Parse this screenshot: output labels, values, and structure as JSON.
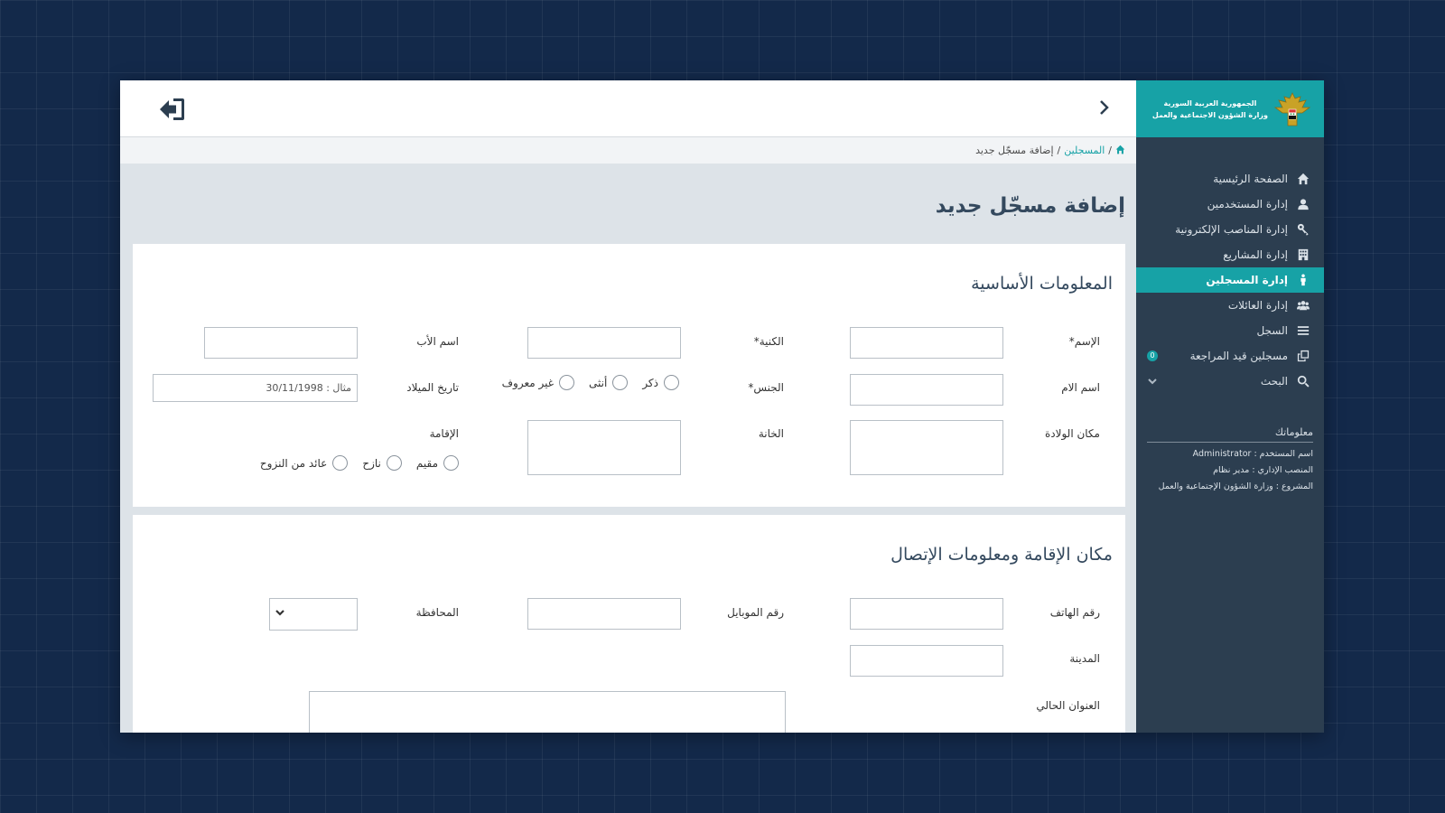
{
  "sidebar": {
    "logo_lines": [
      "الجمهورية العربية السورية",
      "وزارة الشؤون الاجتماعية والعمل"
    ],
    "items": [
      {
        "label": "الصفحة الرئيسية",
        "icon": "home-icon"
      },
      {
        "label": "إدارة المستخدمين",
        "icon": "user-icon"
      },
      {
        "label": "إدارة المناصب الإلكترونية",
        "icon": "key-icon"
      },
      {
        "label": "إدارة المشاريع",
        "icon": "building-icon"
      },
      {
        "label": "إدارة المسجلين",
        "icon": "person-icon",
        "active": true
      },
      {
        "label": "إدارة العائلات",
        "icon": "users-icon"
      },
      {
        "label": "السجل",
        "icon": "list-icon"
      },
      {
        "label": "مسجلين قيد المراجعة",
        "icon": "clone-icon",
        "badge": "0"
      },
      {
        "label": "البحث",
        "icon": "search-icon"
      }
    ],
    "info": {
      "title": "معلوماتك",
      "username": "اسم المستخدم : Administrator",
      "role": "المنصب الإداري : مدير نظام",
      "project": "المشروع : وزارة الشؤون الإجتماعية والعمل"
    }
  },
  "breadcrumb": {
    "link": "المسجلين",
    "separator1": "/",
    "separator2": "/",
    "current": "إضافة مسجّل جديد"
  },
  "page": {
    "title": "إضافة مسجّل جديد"
  },
  "basic_info": {
    "title": "المعلومات الأساسية",
    "first_name_label": "الإسم*",
    "surname_label": "الكنية*",
    "father_name_label": "اسم الأب",
    "mother_name_label": "اسم الام",
    "gender_label": "الجنس*",
    "gender_options": [
      "ذكر",
      "أنثى",
      "غير معروف"
    ],
    "birth_date_label": "تاريخ الميلاد",
    "birth_date_placeholder": "مثال : 30/11/1998",
    "birth_place_label": "مكان الولادة",
    "registry_label": "الخانة",
    "residence_label": "الإقامة",
    "residence_options": [
      "مقيم",
      "نازح",
      "عائد من النزوح"
    ]
  },
  "contact_info": {
    "title": "مكان الإقامة ومعلومات الإتصال",
    "phone_label": "رقم الهاتف",
    "mobile_label": "رقم الموبايل",
    "governorate_label": "المحافظة",
    "city_label": "المدينة",
    "address_label": "العنوان الحالي"
  },
  "colors": {
    "accent": "#17a2a6",
    "sidebar": "#2c3e50",
    "background": "#13294a"
  }
}
